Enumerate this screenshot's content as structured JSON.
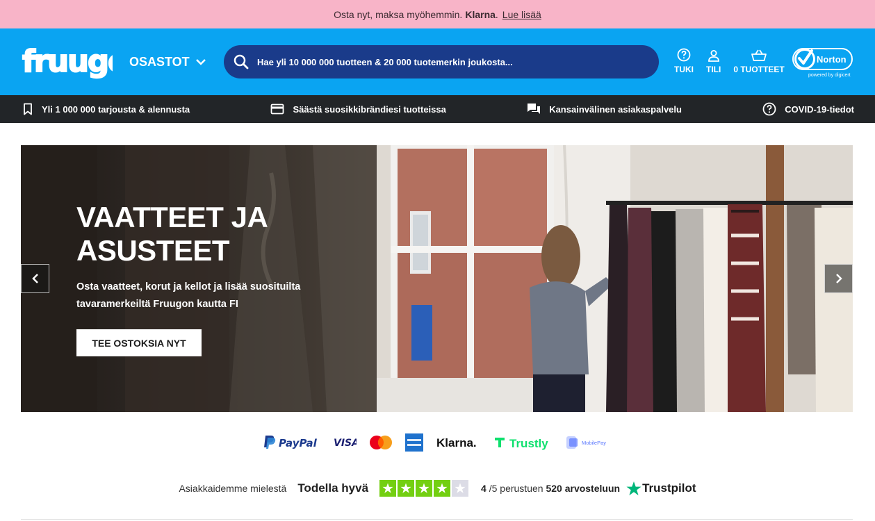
{
  "promo": {
    "text": "Osta nyt, maksa myöhemmin.",
    "brand": "Klarna",
    "period": ".",
    "link": "Lue lisää",
    "color": "#f8b4c8"
  },
  "header": {
    "logo_text": "fruugo",
    "departments_label": "OSASTOT",
    "search_placeholder": "Hae yli 10 000 000 tuotteen & 20 000 tuotemerkin joukosta...",
    "actions": [
      {
        "label": "TUKI",
        "icon": "help-circle-icon"
      },
      {
        "label": "TILI",
        "icon": "user-icon"
      },
      {
        "label": "0 TUOTTEET",
        "icon": "basket-icon"
      }
    ],
    "norton": {
      "name": "Norton",
      "tagline": "powered by digicert"
    },
    "color": "#0aa4f2",
    "search_color": "#1a3b8a"
  },
  "features": [
    {
      "label": "Yli 1 000 000 tarjousta & alennusta",
      "icon": "bookmark-icon"
    },
    {
      "label": "Säästä suosikkibrändiesi tuotteissa",
      "icon": "card-icon"
    },
    {
      "label": "Kansainvälinen asiakaspalvelu",
      "icon": "chat-icon"
    },
    {
      "label": "COVID-19-tiedot",
      "icon": "help-circle-icon"
    }
  ],
  "hero": {
    "title_line1": "VAATTEET JA",
    "title_line2": "ASUSTEET",
    "subtitle": "Osta vaatteet, korut ja kellot ja lisää suosituilta tavaramerkeiltä Fruugon kautta FI",
    "cta": "TEE OSTOKSIA NYT"
  },
  "payments": [
    "PayPal",
    "VISA",
    "Mastercard",
    "American Express",
    "Klarna.",
    "Trustly",
    "MobilePay"
  ],
  "trustpilot": {
    "lead": "Asiakkaidemme mielestä",
    "rating_word": "Todella hyvä",
    "stars_filled": 4,
    "stars_total": 5,
    "score": "4",
    "score_suffix": "/5 perustuen",
    "review_count": "520",
    "review_suffix": "arvosteluun",
    "brand": "Trustpilot",
    "star_color": "#73cf11",
    "star_empty_color": "#dcdce6"
  }
}
